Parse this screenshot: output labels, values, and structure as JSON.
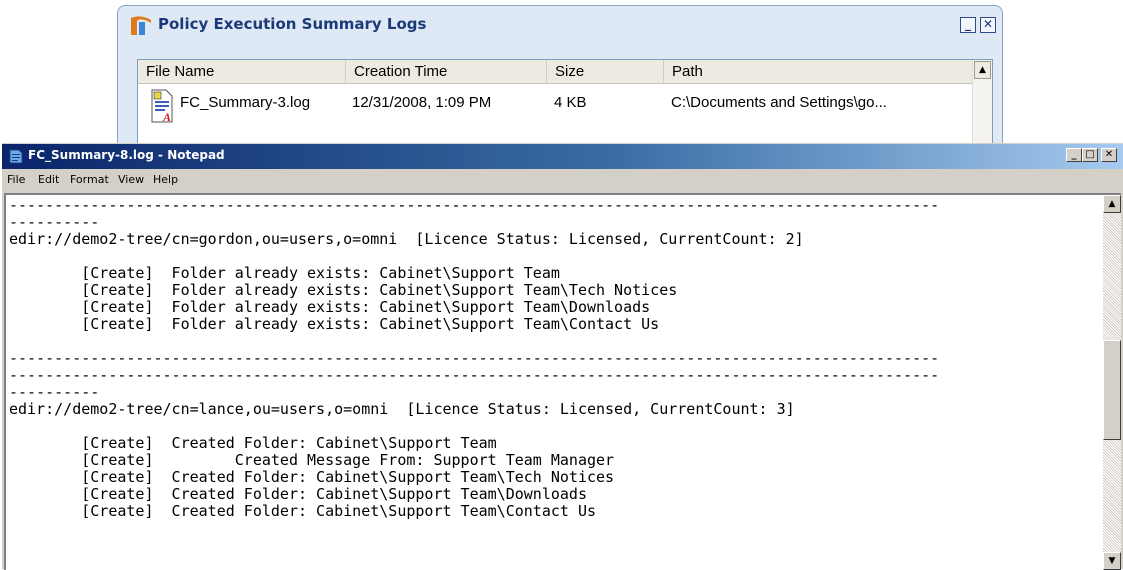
{
  "summary_window": {
    "title": "Policy Execution Summary Logs",
    "minimize_icon": "minimize-icon",
    "close_icon": "close-icon",
    "columns": [
      "File Name",
      "Creation Time",
      "Size",
      "Path"
    ],
    "rows": [
      {
        "file_name": "FC_Summary-3.log",
        "creation_time": "12/31/2008, 1:09 PM",
        "size": "4 KB",
        "path": "C:\\Documents and Settings\\go..."
      }
    ]
  },
  "notepad": {
    "title": "FC_Summary-8.log - Notepad",
    "menu": [
      "File",
      "Edit",
      "Format",
      "View",
      "Help"
    ],
    "content": "-------------------------------------------------------------------------------------------------------\n----------\nedir://demo2-tree/cn=gordon,ou=users,o=omni  [Licence Status: Licensed, CurrentCount: 2]\n\n        [Create]  Folder already exists: Cabinet\\Support Team\n        [Create]  Folder already exists: Cabinet\\Support Team\\Tech Notices\n        [Create]  Folder already exists: Cabinet\\Support Team\\Downloads\n        [Create]  Folder already exists: Cabinet\\Support Team\\Contact Us\n\n-------------------------------------------------------------------------------------------------------\n-------------------------------------------------------------------------------------------------------\n----------\nedir://demo2-tree/cn=lance,ou=users,o=omni  [Licence Status: Licensed, CurrentCount: 3]\n\n        [Create]  Created Folder: Cabinet\\Support Team\n        [Create]         Created Message From: Support Team Manager\n        [Create]  Created Folder: Cabinet\\Support Team\\Tech Notices\n        [Create]  Created Folder: Cabinet\\Support Team\\Downloads\n        [Create]  Created Folder: Cabinet\\Support Team\\Contact Us"
  },
  "colors": {
    "titlebar_start": "#0a246a",
    "titlebar_end": "#a6caf0",
    "window_face": "#d4d0c8",
    "summary_bg": "#dfe9f5"
  }
}
